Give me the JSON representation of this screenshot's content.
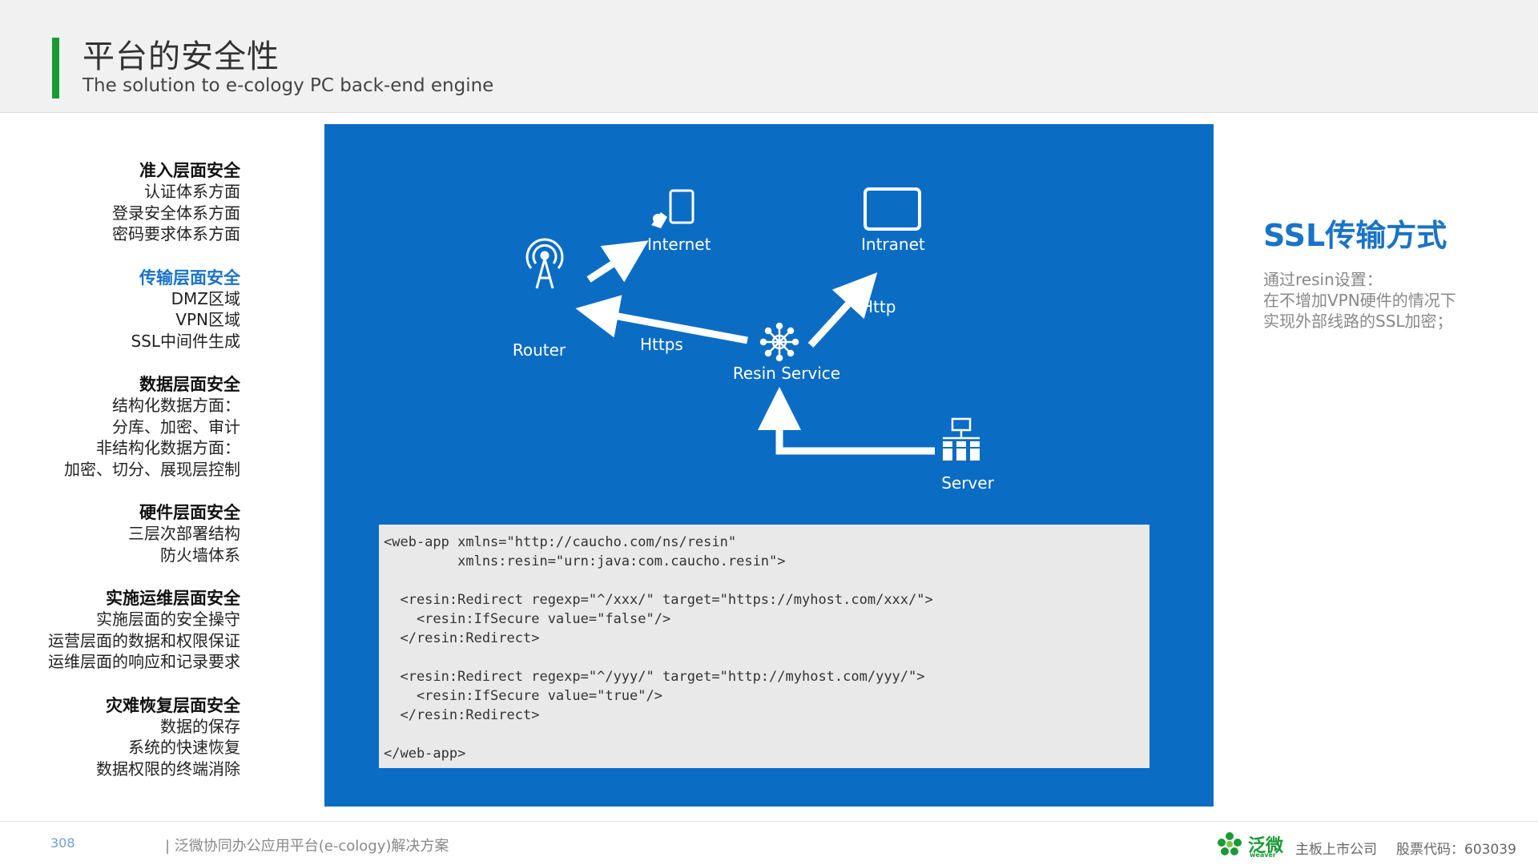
{
  "header": {
    "title": "平台的安全性",
    "subtitle": "The solution to e-cology PC back-end engine",
    "accent_color": "#1a9a34"
  },
  "left_nav": {
    "groups": [
      {
        "heading": "准入层面安全",
        "items": [
          "认证体系方面",
          "登录安全体系方面",
          "密码要求体系方面"
        ]
      },
      {
        "heading": "传输层面安全",
        "active": true,
        "items": [
          "DMZ区域",
          "VPN区域",
          "SSL中间件生成"
        ]
      },
      {
        "heading": "数据层面安全",
        "items": [
          "结构化数据方面：",
          "分库、加密、审计",
          "非结构化数据方面：",
          "加密、切分、展现层控制"
        ]
      },
      {
        "heading": "硬件层面安全",
        "items": [
          "三层次部署结构",
          "防火墙体系"
        ]
      },
      {
        "heading": "实施运维层面安全",
        "items": [
          "实施层面的安全操守",
          "运营层面的数据和权限保证",
          "运维层面的响应和记录要求"
        ]
      },
      {
        "heading": "灾难恢复层面安全",
        "items": [
          "数据的保存",
          "系统的快速恢复",
          "数据权限的终端消除"
        ]
      }
    ]
  },
  "diagram": {
    "background": "#0b6cc4",
    "nodes": {
      "internet": "Internet",
      "intranet": "Intranet",
      "router": "Router",
      "resin": "Resin Service",
      "server": "Server"
    },
    "edges": {
      "https": "Https",
      "http": "Http"
    },
    "icons": [
      "tablet-touch-icon",
      "tablet-icon",
      "antenna-icon",
      "network-hub-icon",
      "server-cluster-icon"
    ]
  },
  "code": {
    "lines": [
      "<web-app xmlns=\"http://caucho.com/ns/resin\"",
      "         xmlns:resin=\"urn:java:com.caucho.resin\">",
      "",
      "  <resin:Redirect regexp=\"^/xxx/\" target=\"https://myhost.com/xxx/\">",
      "    <resin:IfSecure value=\"false\"/>",
      "  </resin:Redirect>",
      "",
      "  <resin:Redirect regexp=\"^/yyy/\" target=\"http://myhost.com/yyy/\">",
      "    <resin:IfSecure value=\"true\"/>",
      "  </resin:Redirect>",
      "",
      "</web-app>"
    ]
  },
  "right_panel": {
    "title": "SSL传输方式",
    "description": [
      "通过resin设置：",
      "在不增加VPN硬件的情况下",
      "实现外部线路的SSL加密；"
    ]
  },
  "footer": {
    "page_number": "308",
    "text": "| 泛微协同办公应用平台(e-cology)解决方案",
    "logo_text": "泛微",
    "logo_sub": "weaver",
    "company": "主板上市公司",
    "stock": "股票代码：603039"
  }
}
